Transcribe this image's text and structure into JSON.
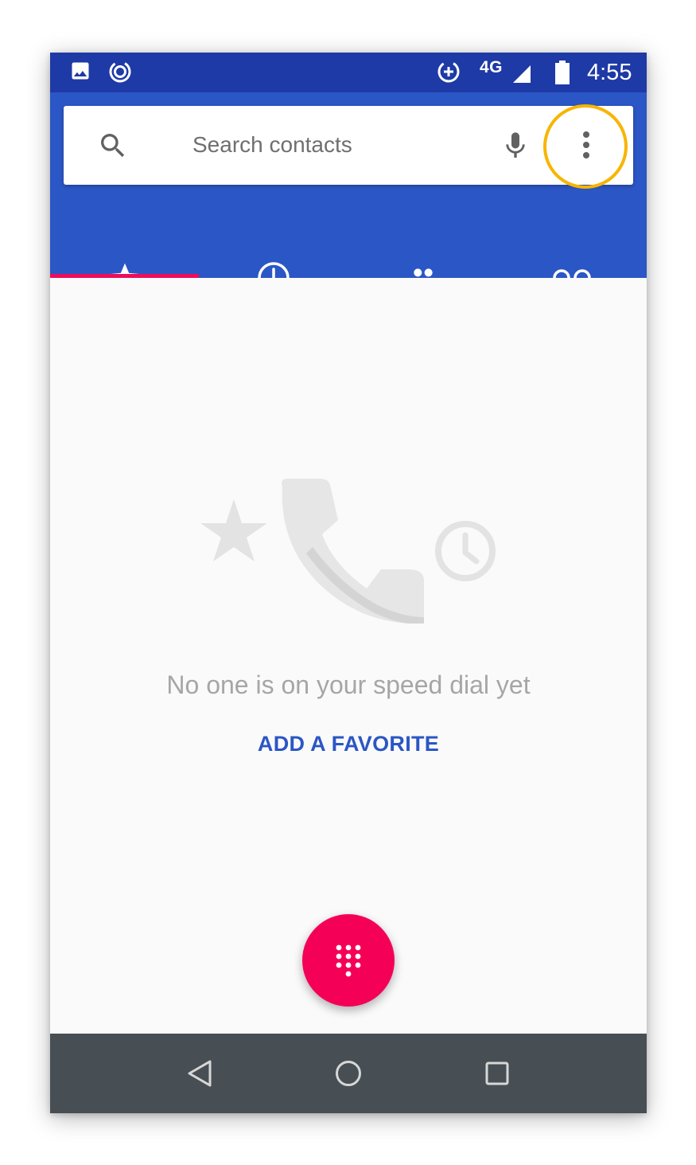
{
  "status_bar": {
    "network_label": "4G",
    "time": "4:55",
    "icons": [
      "gallery-icon",
      "data-saver-icon",
      "data-saver-plus-icon",
      "signal-icon",
      "battery-icon"
    ]
  },
  "search": {
    "placeholder": "Search contacts",
    "icons": [
      "search-icon",
      "mic-icon",
      "more-vert-icon"
    ]
  },
  "tabs": [
    {
      "id": "speed-dial",
      "icon": "star-icon",
      "selected": true
    },
    {
      "id": "recents",
      "icon": "clock-icon",
      "selected": false
    },
    {
      "id": "contacts",
      "icon": "people-icon",
      "selected": false
    },
    {
      "id": "voicemail",
      "icon": "voicemail-icon",
      "selected": false
    }
  ],
  "empty_state": {
    "message": "No one is on your speed dial yet",
    "action_label": "ADD A FAVORITE"
  },
  "fab": {
    "icon": "dialpad-icon"
  },
  "nav_bar": {
    "buttons": [
      "back-icon",
      "home-icon",
      "recents-icon"
    ]
  },
  "colors": {
    "status_bar": "#1e3aa6",
    "app_bar": "#2b56c5",
    "accent": "#f50057",
    "tab_indicator": "#ec0e5c",
    "highlight_ring": "#f7b500",
    "nav_bar": "#474f54"
  }
}
